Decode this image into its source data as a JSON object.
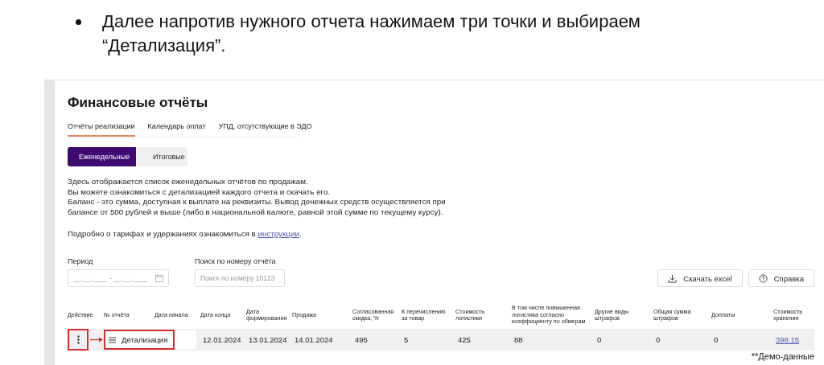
{
  "slide": {
    "bullet": "Далее напротив нужного отчета нажимаем три точки и выбираем “Детализация”."
  },
  "page": {
    "title": "Финансовые отчёты",
    "tabs": [
      {
        "label": "Отчёты реализации",
        "selected": true
      },
      {
        "label": "Календарь оплат",
        "selected": false
      },
      {
        "label": "УПД, отсутствующие в ЭДО",
        "selected": false
      }
    ],
    "period_toggle": [
      {
        "label": "Еженедельные",
        "selected": true
      },
      {
        "label": "Итоговые",
        "selected": false
      }
    ],
    "description": [
      "Здесь отображается список еженедельных отчётов по продажам.",
      "Вы можете ознакомиться с детализацией каждого отчета и скачать его.",
      "Баланс - это сумма, доступная к выплате на реквизиты. Вывод денежных средств осуществляется при",
      "балансе от 500 рублей и выше (либо в национальной валюте, равной этой сумме по текущему курсу)."
    ],
    "info": {
      "text": "Подробно о тарифах и удержаниях ознакомиться в ",
      "link": "инструкции",
      "after": "."
    },
    "filters": {
      "period": {
        "label": "Период",
        "placeholder": "__.__.____ - __.__.____"
      },
      "search": {
        "label": "Поиск по номеру отчёта",
        "placeholder": "Поиск по номеру 10123"
      }
    },
    "buttons": [
      {
        "kind": "download",
        "label": "Скачать excel"
      },
      {
        "kind": "help",
        "label": "Справка"
      }
    ],
    "table": {
      "columns": [
        "Действие",
        "№ отчёта",
        "Дата начала",
        "Дата конца",
        "Дата формирования",
        "Продажа",
        "Согласованная скидка, %",
        "К перечислению за товар",
        "Стоимость логистики",
        "В том числе повышенная логистика согласно коэффициенту по обмерам",
        "Другие виды штрафов",
        "Общая сумма штрафов",
        "Доплаты",
        "Стоимость хранения"
      ],
      "row": {
        "menu_item": "Детализация",
        "cells": [
          "12.01.2024",
          "13.01.2024",
          "14.01.2024",
          "495",
          "5",
          "425",
          "88",
          "0",
          "0",
          "0"
        ],
        "storage_link": "398.15"
      }
    },
    "footnote": "**Демо-данные"
  }
}
